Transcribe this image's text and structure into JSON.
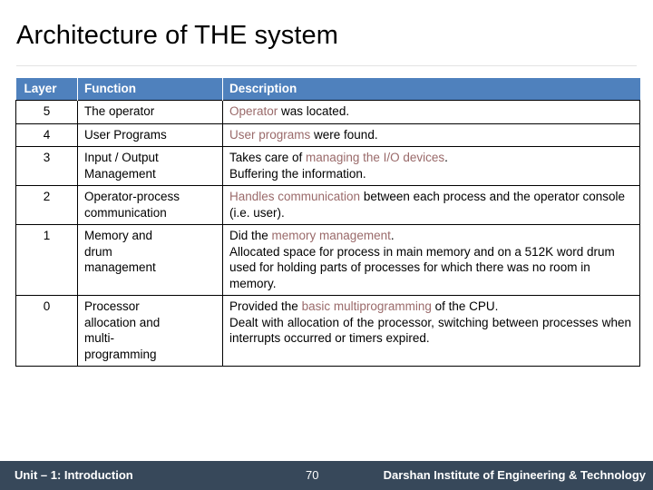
{
  "slide": {
    "title": "Architecture of THE system",
    "accent_color": "#9a6a6a",
    "header_color": "#4f81bd",
    "footer_color": "#37485a"
  },
  "table": {
    "headers": {
      "layer": "Layer",
      "function": "Function",
      "description": "Description"
    },
    "rows": [
      {
        "layer": "5",
        "function": "The operator",
        "description_parts": [
          {
            "text": "Operator",
            "highlight": true
          },
          {
            "text": " was located.",
            "highlight": false
          }
        ]
      },
      {
        "layer": "4",
        "function": "User Programs",
        "description_parts": [
          {
            "text": "User programs",
            "highlight": true
          },
          {
            "text": " were found.",
            "highlight": false
          }
        ]
      },
      {
        "layer": "3",
        "function": "Input / Output Management",
        "description_parts": [
          {
            "text": "Takes care of ",
            "highlight": false
          },
          {
            "text": "managing the I/O devices",
            "highlight": true
          },
          {
            "text": ". Buffering the information.",
            "highlight": false
          }
        ]
      },
      {
        "layer": "2",
        "function": "Operator-process communication",
        "description_parts": [
          {
            "text": "Handles communication",
            "highlight": true
          },
          {
            "text": " between each process and the operator console (i.e. user).",
            "highlight": false
          }
        ]
      },
      {
        "layer": "1",
        "function": "Memory and drum management",
        "description_parts": [
          {
            "text": "Did the ",
            "highlight": false
          },
          {
            "text": "memory management",
            "highlight": true
          },
          {
            "text": ". Allocated space for process in main memory and on a 512K word drum used for holding parts of processes for which there was no room in memory.",
            "highlight": false
          }
        ]
      },
      {
        "layer": "0",
        "function": "Processor allocation and multi-programming",
        "description_parts": [
          {
            "text": "Provided the ",
            "highlight": false
          },
          {
            "text": "basic multiprogramming",
            "highlight": true
          },
          {
            "text": " of the CPU. Dealt with allocation of the processor, switching between processes when interrupts occurred or timers expired.",
            "highlight": false
          }
        ]
      }
    ],
    "cells": {
      "r0_layer": "5",
      "r0_function": "The operator",
      "r0_desc_hl": "Operator",
      "r0_desc_rest": " was located.",
      "r1_layer": "4",
      "r1_function": "User Programs",
      "r1_desc_hl": "User programs",
      "r1_desc_rest": " were found.",
      "r2_layer": "3",
      "r2_function_l1": "Input / Output",
      "r2_function_l2": "Management",
      "r2_desc_pre": "Takes care of ",
      "r2_desc_hl": "managing the I/O devices",
      "r2_desc_post": ".",
      "r2_desc_l2": "Buffering the information.",
      "r3_layer": "2",
      "r3_function_l1": "Operator-process",
      "r3_function_l2": "communication",
      "r3_desc_hl": "Handles communication",
      "r3_desc_rest": " between each process and the operator console (i.e. user).",
      "r4_layer": "1",
      "r4_function_l1": "Memory and",
      "r4_function_l2": "drum",
      "r4_function_l3": "management",
      "r4_desc_pre": "Did the ",
      "r4_desc_hl": "memory management",
      "r4_desc_post": ".",
      "r4_desc_body": "Allocated space for process in main memory and on a 512K word drum used for holding parts of processes for which there was no room in memory.",
      "r5_layer": "0",
      "r5_function_l1": "Processor",
      "r5_function_l2": "allocation and",
      "r5_function_l3": "multi-",
      "r5_function_l4": "programming",
      "r5_desc_pre": "Provided the ",
      "r5_desc_hl": "basic multiprogramming",
      "r5_desc_post": " of the CPU.",
      "r5_desc_body": "Dealt with allocation of the processor, switching between processes when interrupts occurred or timers expired."
    }
  },
  "footer": {
    "unit": "Unit – 1: Introduction",
    "page_number": "70",
    "institute": "Darshan Institute of Engineering & Technology"
  }
}
